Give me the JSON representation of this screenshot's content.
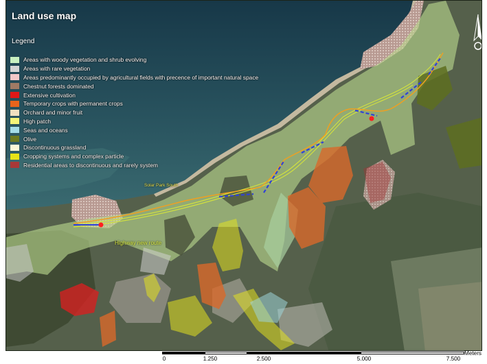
{
  "map": {
    "title": "Land use map",
    "legend_heading": "Legend",
    "legend": [
      {
        "label": "Areas with woody vegetation and shrub evolving",
        "color": "#c8f0c0"
      },
      {
        "label": "Areas with rare vegetation",
        "color": "#d4d4d4"
      },
      {
        "label": "Areas predominantly occupied by agricultural fields with precence of important natural space",
        "color": "#f4c8c8"
      },
      {
        "label": "Chestnut forests dominated",
        "color": "#a07a64"
      },
      {
        "label": "Extensive cultivation",
        "color": "#e01818"
      },
      {
        "label": "Temporary crops with permanent crops",
        "color": "#e8641c"
      },
      {
        "label": "Orchard and minor fruit",
        "color": "#f0e0c0"
      },
      {
        "label": "High patch",
        "color": "#f4f478"
      },
      {
        "label": "Seas and oceans",
        "color": "#a4dce8"
      },
      {
        "label": "Olive",
        "color": "#6c7a20"
      },
      {
        "label": "Discontinuous grassland",
        "color": "#fcf8d8"
      },
      {
        "label": "Cropping systems and complex particle",
        "color": "#e8e418"
      },
      {
        "label": "Residential areas to discontinuous and rarely system",
        "color": "#a83838"
      }
    ],
    "labels": {
      "solar_park": "Solar Park South",
      "highway": "Highway new route"
    },
    "colors": {
      "sea": "#2f5560",
      "land": "#5a6450",
      "route_orange": "#f0a020",
      "route_yellow": "#d0e040",
      "route_blue": "#3040d8",
      "endpoint": "#ff2020"
    },
    "north_icon": "north-arrow-icon"
  },
  "scale": {
    "unit": "Meters",
    "ticks": [
      "0",
      "1.250",
      "2.500",
      "5.000",
      "7.500"
    ]
  }
}
